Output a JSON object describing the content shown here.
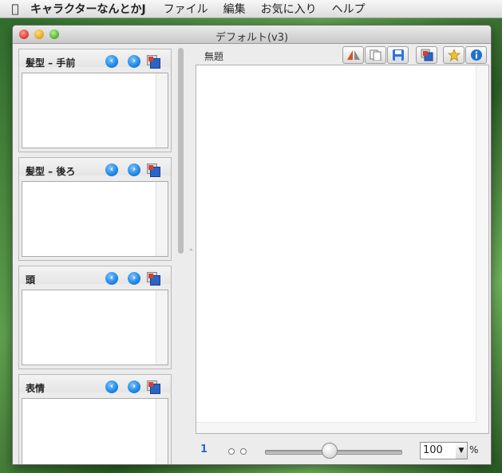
{
  "menubar": {
    "apple_icon": "apple-icon",
    "app_name": "キャラクターなんとかJ",
    "items": [
      "ファイル",
      "編集",
      "お気に入り",
      "ヘルプ"
    ]
  },
  "window": {
    "title": "デフォルト(v3)"
  },
  "panels": [
    {
      "label": "髪型 – 手前"
    },
    {
      "label": "髪型 – 後ろ"
    },
    {
      "label": "頭"
    },
    {
      "label": "表情"
    }
  ],
  "editor": {
    "title": "無題",
    "toolbar_icons": [
      "flip-icon",
      "copy-pages-icon",
      "save-icon",
      "copy-layer-icon",
      "favorite-star-icon",
      "info-icon"
    ]
  },
  "footer": {
    "zoom_value": "100",
    "zoom_unit": "%",
    "zoom_slider_fraction": 0.47
  },
  "colors": {
    "accent_blue": "#1d86e6",
    "star_yellow": "#f2c12e"
  }
}
